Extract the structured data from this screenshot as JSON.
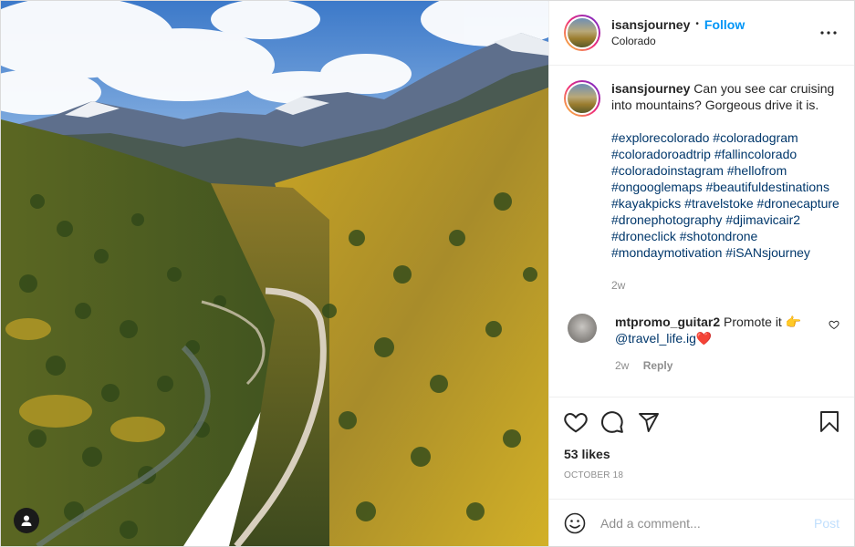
{
  "post": {
    "image_alt": "Aerial view of a road through an autumn valley with aspens and snowy mountains",
    "tag_icon": "user-icon"
  },
  "header": {
    "username": "isansjourney",
    "separator": "•",
    "follow_label": "Follow",
    "location": "Colorado",
    "more_icon": "more-icon"
  },
  "caption": {
    "username": "isansjourney",
    "text": "Can you see car cruising into mountains? Gorgeous drive it is.",
    "hashtags": [
      "#explorecolorado",
      "#coloradogram",
      "#coloradoroadtrip",
      "#fallincolorado",
      "#coloradoinstagram",
      "#hellofrom",
      "#ongooglemaps",
      "#beautifuldestinations",
      "#kayakpicks",
      "#travelstoke",
      "#dronecapture",
      "#dronephotography",
      "#djimavicair2",
      "#droneclick",
      "#shotondrone",
      "#mondaymotivation",
      "#iSANsjourney"
    ],
    "time": "2w"
  },
  "comments": [
    {
      "username": "mtpromo_guitar2",
      "text": "Promote it 👉",
      "mention": "@travel_life.ig",
      "emoji": "❤️",
      "time": "2w",
      "reply_label": "Reply"
    }
  ],
  "actions": {
    "like_icon": "heart-icon",
    "comment_icon": "comment-icon",
    "share_icon": "share-icon",
    "save_icon": "bookmark-icon",
    "likes": "53 likes",
    "date": "OCTOBER 18"
  },
  "add_comment": {
    "placeholder": "Add a comment...",
    "post_label": "Post",
    "emoji_icon": "emoji-icon"
  },
  "colors": {
    "link": "#0095f6",
    "hashtag": "#00376b",
    "muted": "#8e8e8e",
    "border": "#efefef"
  }
}
